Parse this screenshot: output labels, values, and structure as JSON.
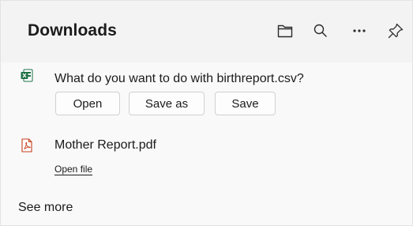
{
  "header": {
    "title": "Downloads",
    "icons": [
      "folder-icon",
      "search-icon",
      "more-icon",
      "pin-icon"
    ]
  },
  "downloads": [
    {
      "icon": "excel-csv-icon",
      "prompt": "What do you want to do with birthreport.csv?",
      "actions": {
        "open": "Open",
        "save_as": "Save as",
        "save": "Save"
      }
    },
    {
      "icon": "pdf-icon",
      "filename": "Mother Report.pdf",
      "link": "Open file"
    }
  ],
  "footer": {
    "see_more": "See more"
  },
  "colors": {
    "excel_green": "#1e7145",
    "pdf_red": "#c43e1c",
    "background": "#f9f9f9"
  }
}
